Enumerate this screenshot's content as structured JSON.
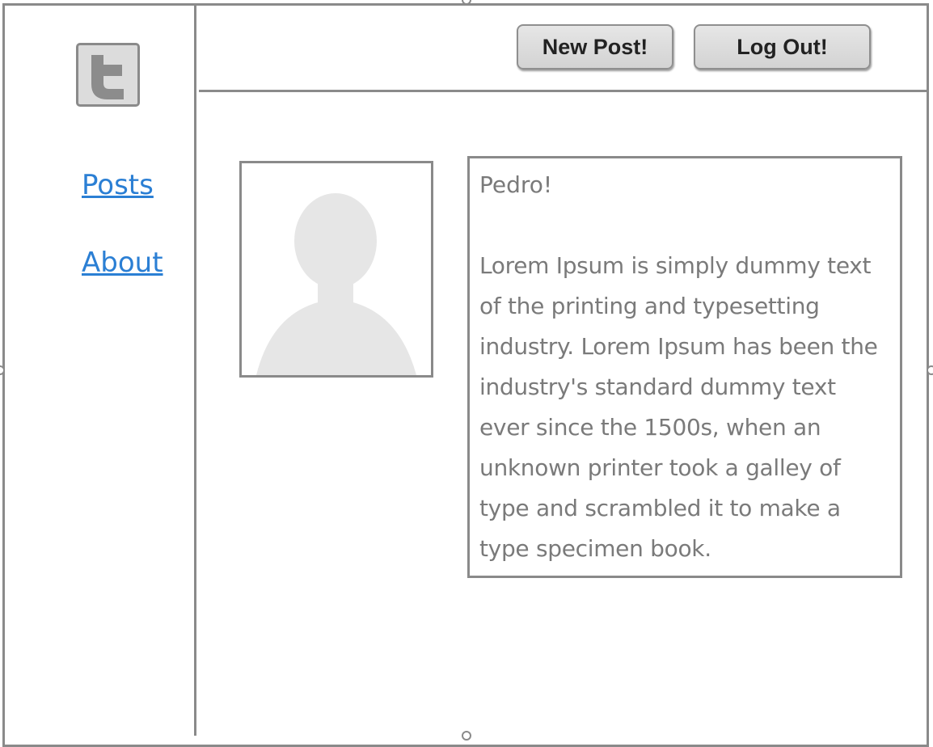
{
  "sidebar": {
    "logo_icon": "twitter-t-icon",
    "items": [
      {
        "label": "Posts"
      },
      {
        "label": "About"
      }
    ]
  },
  "header": {
    "new_post_label": "New Post!",
    "log_out_label": "Log Out!"
  },
  "post": {
    "avatar_icon": "user-silhouette-icon",
    "author": "Pedro!",
    "body": "Lorem Ipsum is simply dummy text of the printing and typesetting industry. Lorem Ipsum has been the industry's standard dummy text ever since the 1500s, when an unknown printer took a galley of type and scrambled it to make a type specimen book."
  },
  "colors": {
    "link": "#2b7fd4",
    "border": "#8a8a8a",
    "text": "#7a7a7a",
    "button_bg": "#dcdcdc"
  }
}
